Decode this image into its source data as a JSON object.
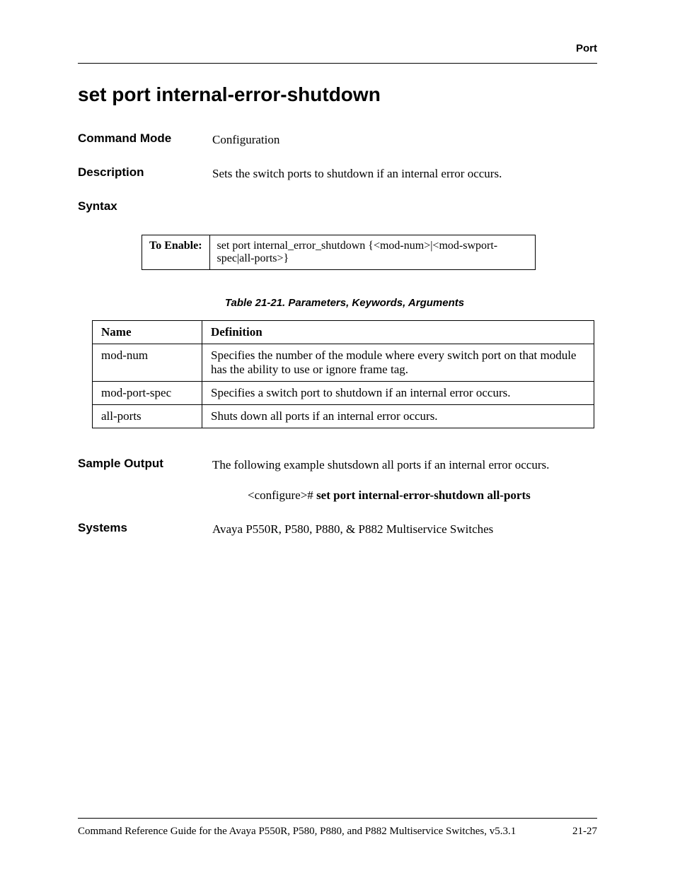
{
  "header": {
    "section": "Port"
  },
  "title": "set port internal-error-shutdown",
  "commandMode": {
    "label": "Command Mode",
    "value": "Configuration"
  },
  "description": {
    "label": "Description",
    "value": "Sets the switch ports to shutdown if an internal error occurs."
  },
  "syntax": {
    "label": "Syntax",
    "enableLabel": "To Enable:",
    "enableCommand": "set port internal_error_shutdown {<mod-num>|<mod-swport-spec|all-ports>}"
  },
  "paramTable": {
    "caption": "Table 21-21.  Parameters, Keywords, Arguments",
    "headers": {
      "name": "Name",
      "definition": "Definition"
    },
    "rows": [
      {
        "name": "mod-num",
        "definition": "Specifies the number of the module where every switch port on that module has the ability to use or ignore frame tag."
      },
      {
        "name": "mod-port-spec",
        "definition": "Specifies a switch port to shutdown if an internal error occurs."
      },
      {
        "name": "all-ports",
        "definition": "Shuts down all ports if an internal error occurs."
      }
    ]
  },
  "sampleOutput": {
    "label": "Sample Output",
    "text": "The following example shutsdown all ports if an internal error occurs.",
    "prompt": "<configure># ",
    "command": "set port internal-error-shutdown all-ports"
  },
  "systems": {
    "label": "Systems",
    "value": "Avaya P550R, P580, P880, & P882 Multiservice Switches"
  },
  "footer": {
    "left": "Command Reference Guide for the Avaya P550R, P580, P880, and P882 Multiservice Switches, v5.3.1",
    "right": "21-27"
  }
}
